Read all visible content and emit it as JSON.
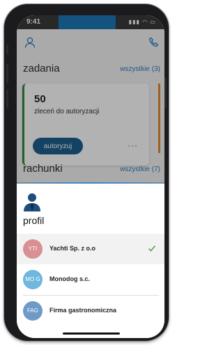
{
  "status_bar": {
    "time": "9:41",
    "signal_icon": "signal-wifi-battery-icons"
  },
  "dashboard": {
    "user_icon": "user-icon",
    "phone_icon": "phone-icon",
    "tasks_title": "zadania",
    "tasks_link": "wszystkie (3)",
    "task_card": {
      "count": "50",
      "description": "zleceń do autoryzacji",
      "button": "autoryzuj",
      "more": "···"
    },
    "bills_title": "rachunki",
    "bills_link": "wszystkie (7)"
  },
  "sheet": {
    "icon": "profile-icon",
    "title": "profil",
    "accounts": [
      {
        "initials": "YTI",
        "name": "Yachti Sp. z o.o",
        "color": "#d98f94",
        "selected": true
      },
      {
        "initials": "MO G",
        "name": "Monodog s.c.",
        "color": "#6fb7dc",
        "selected": false
      },
      {
        "initials": "FAG",
        "name": "Firma gastronomiczna",
        "color": "#6f9ac7",
        "selected": false
      }
    ]
  }
}
